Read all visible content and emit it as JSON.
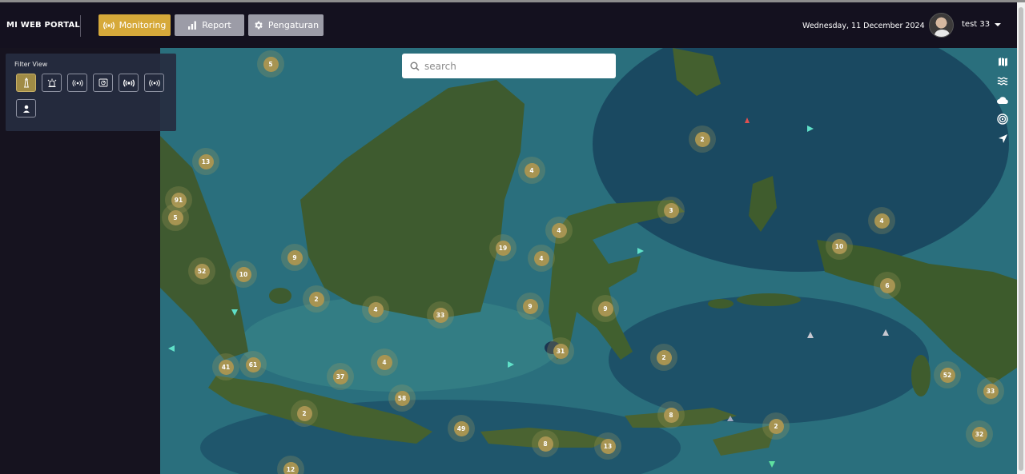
{
  "header": {
    "brand": "MI WEB PORTAL",
    "nav": [
      {
        "label": "Monitoring",
        "icon": "broadcast-icon",
        "active": true
      },
      {
        "label": "Report",
        "icon": "bar-chart-icon",
        "active": false
      },
      {
        "label": "Pengaturan",
        "icon": "gear-icon",
        "active": false
      }
    ],
    "date": "Wednesday, 11 December 2024",
    "user": "test 33"
  },
  "filter": {
    "title": "Filter View",
    "buttons": [
      "lighthouse-icon",
      "alarm-icon",
      "broadcast-icon",
      "radar-icon",
      "broadcast-strong-icon",
      "broadcast-wide-icon",
      "person-pin-icon"
    ]
  },
  "search": {
    "placeholder": "search"
  },
  "map_tools": [
    "map-icon",
    "waves-icon",
    "cloud-icon",
    "target-icon",
    "navigation-icon"
  ],
  "clusters": [
    "5",
    "13",
    "91",
    "5",
    "52",
    "10",
    "9",
    "2",
    "4",
    "33",
    "4",
    "19",
    "4",
    "4",
    "9",
    "31",
    "9",
    "2",
    "3",
    "2",
    "4",
    "10",
    "6",
    "52",
    "33",
    "32",
    "41",
    "61",
    "37",
    "4",
    "58",
    "2",
    "49",
    "8",
    "13",
    "8",
    "2",
    "12"
  ],
  "colors": {
    "accent": "#d6a93a",
    "cluster": "#a79452",
    "navbar": "#14111f"
  }
}
